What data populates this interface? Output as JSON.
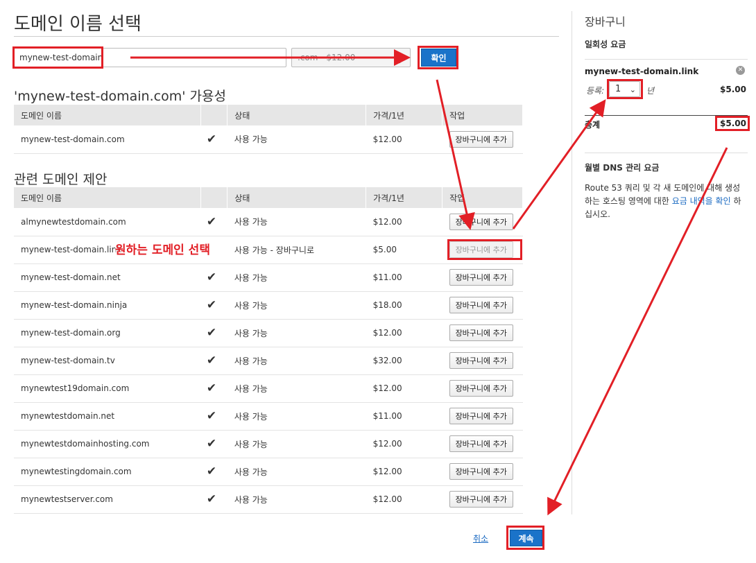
{
  "page": {
    "title": "도메인 이름 선택"
  },
  "search": {
    "value": "mynew-test-domain",
    "tld": ".com - $12.00",
    "confirm_label": "확인"
  },
  "availability": {
    "title": "'mynew-test-domain.com' 가용성",
    "headers": [
      "도메인 이름",
      "",
      "상태",
      "가격/1년",
      "작업"
    ],
    "rows": [
      {
        "domain": "mynew-test-domain.com",
        "status": "사용 가능",
        "price": "$12.00",
        "action": "장바구니에 추가"
      }
    ]
  },
  "suggestions": {
    "title": "관련 도메인 제안",
    "headers": [
      "도메인 이름",
      "",
      "상태",
      "가격/1년",
      "작업"
    ],
    "rows": [
      {
        "domain": "almynewtestdomain.com",
        "status": "사용 가능",
        "price": "$12.00",
        "action": "장바구니에 추가"
      },
      {
        "domain": "mynew-test-domain.link",
        "status": "사용 가능 - 장바구니로",
        "price": "$5.00",
        "action": "장바구니에 추가"
      },
      {
        "domain": "mynew-test-domain.net",
        "status": "사용 가능",
        "price": "$11.00",
        "action": "장바구니에 추가"
      },
      {
        "domain": "mynew-test-domain.ninja",
        "status": "사용 가능",
        "price": "$18.00",
        "action": "장바구니에 추가"
      },
      {
        "domain": "mynew-test-domain.org",
        "status": "사용 가능",
        "price": "$12.00",
        "action": "장바구니에 추가"
      },
      {
        "domain": "mynew-test-domain.tv",
        "status": "사용 가능",
        "price": "$32.00",
        "action": "장바구니에 추가"
      },
      {
        "domain": "mynewtest19domain.com",
        "status": "사용 가능",
        "price": "$12.00",
        "action": "장바구니에 추가"
      },
      {
        "domain": "mynewtestdomain.net",
        "status": "사용 가능",
        "price": "$11.00",
        "action": "장바구니에 추가"
      },
      {
        "domain": "mynewtestdomainhosting.com",
        "status": "사용 가능",
        "price": "$12.00",
        "action": "장바구니에 추가"
      },
      {
        "domain": "mynewtestingdomain.com",
        "status": "사용 가능",
        "price": "$12.00",
        "action": "장바구니에 추가"
      },
      {
        "domain": "mynewtestserver.com",
        "status": "사용 가능",
        "price": "$12.00",
        "action": "장바구니에 추가"
      }
    ]
  },
  "cart": {
    "title": "장바구니",
    "onetime_label": "일회성 요금",
    "item_domain": "mynew-test-domain.link",
    "register_label": "등록:",
    "years": "1",
    "year_unit": "년",
    "item_price": "$5.00",
    "total_label": "총계",
    "total_price": "$5.00",
    "dns_title": "월별 DNS 관리 요금",
    "dns_text": "Route 53 쿼리 및 각 새 도메인에 대해 생성하는 호스팅 영역에 대한",
    "dns_link": "요금 내역을 확인",
    "dns_suffix": "하십시오."
  },
  "footer": {
    "cancel_label": "취소",
    "continue_label": "계속"
  },
  "annotation": {
    "label": "원하는 도메인 선택",
    "color": "#e21f26"
  },
  "icons": {
    "check": "check-icon",
    "remove": "remove-icon",
    "caret": "chevron-down-icon"
  }
}
